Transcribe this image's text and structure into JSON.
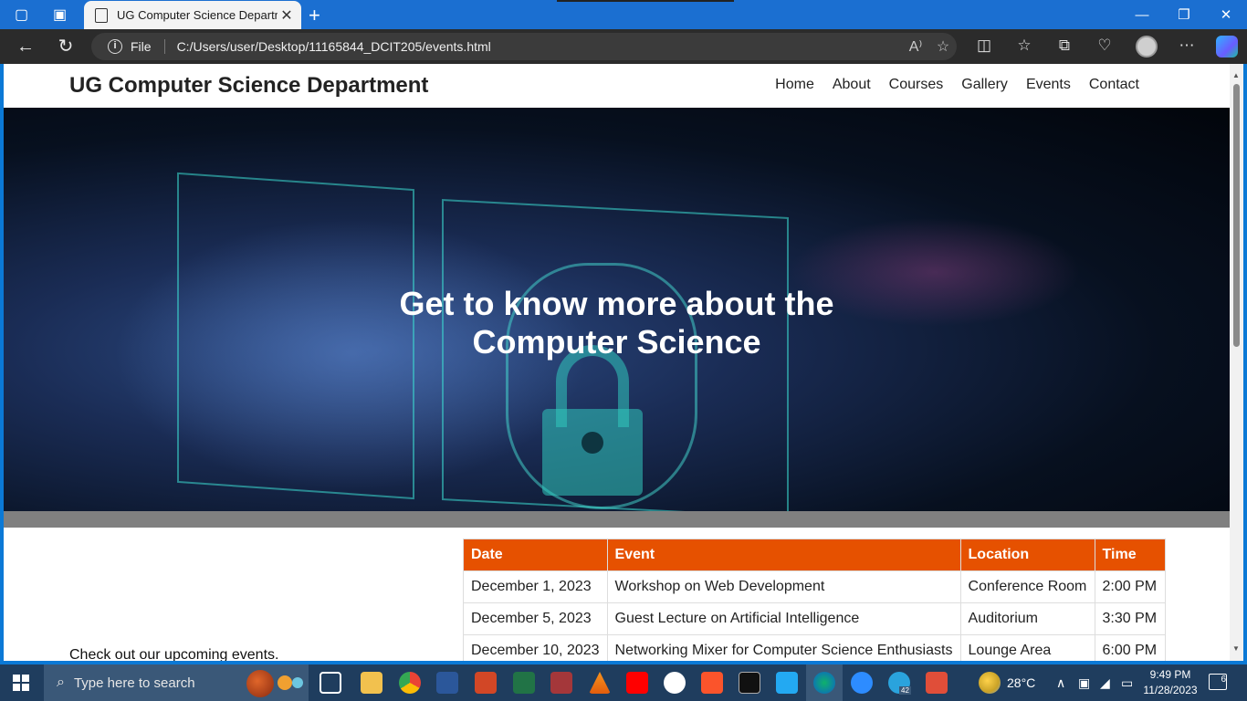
{
  "browser": {
    "tab_title": "UG Computer Science Departme",
    "file_label": "File",
    "url": "C:/Users/user/Desktop/11165844_DCIT205/events.html"
  },
  "site": {
    "title": "UG Computer Science Department",
    "nav": [
      "Home",
      "About",
      "Courses",
      "Gallery",
      "Events",
      "Contact"
    ],
    "hero_line1": "Get to know more about the",
    "hero_line2": "Computer Science",
    "intro": "Check out our upcoming events."
  },
  "events_table": {
    "headers": [
      "Date",
      "Event",
      "Location",
      "Time"
    ],
    "rows": [
      [
        "December 1, 2023",
        "Workshop on Web Development",
        "Conference Room",
        "2:00 PM"
      ],
      [
        "December 5, 2023",
        "Guest Lecture on Artificial Intelligence",
        "Auditorium",
        "3:30 PM"
      ],
      [
        "December 10, 2023",
        "Networking Mixer for Computer Science Enthusiasts",
        "Lounge Area",
        "6:00 PM"
      ]
    ],
    "header_color": "#e65100"
  },
  "taskbar": {
    "search_placeholder": "Type here to search",
    "weather": "28°C",
    "time": "9:49 PM",
    "date": "11/28/2023",
    "notification_count": "6",
    "telegram_badge": "42"
  }
}
